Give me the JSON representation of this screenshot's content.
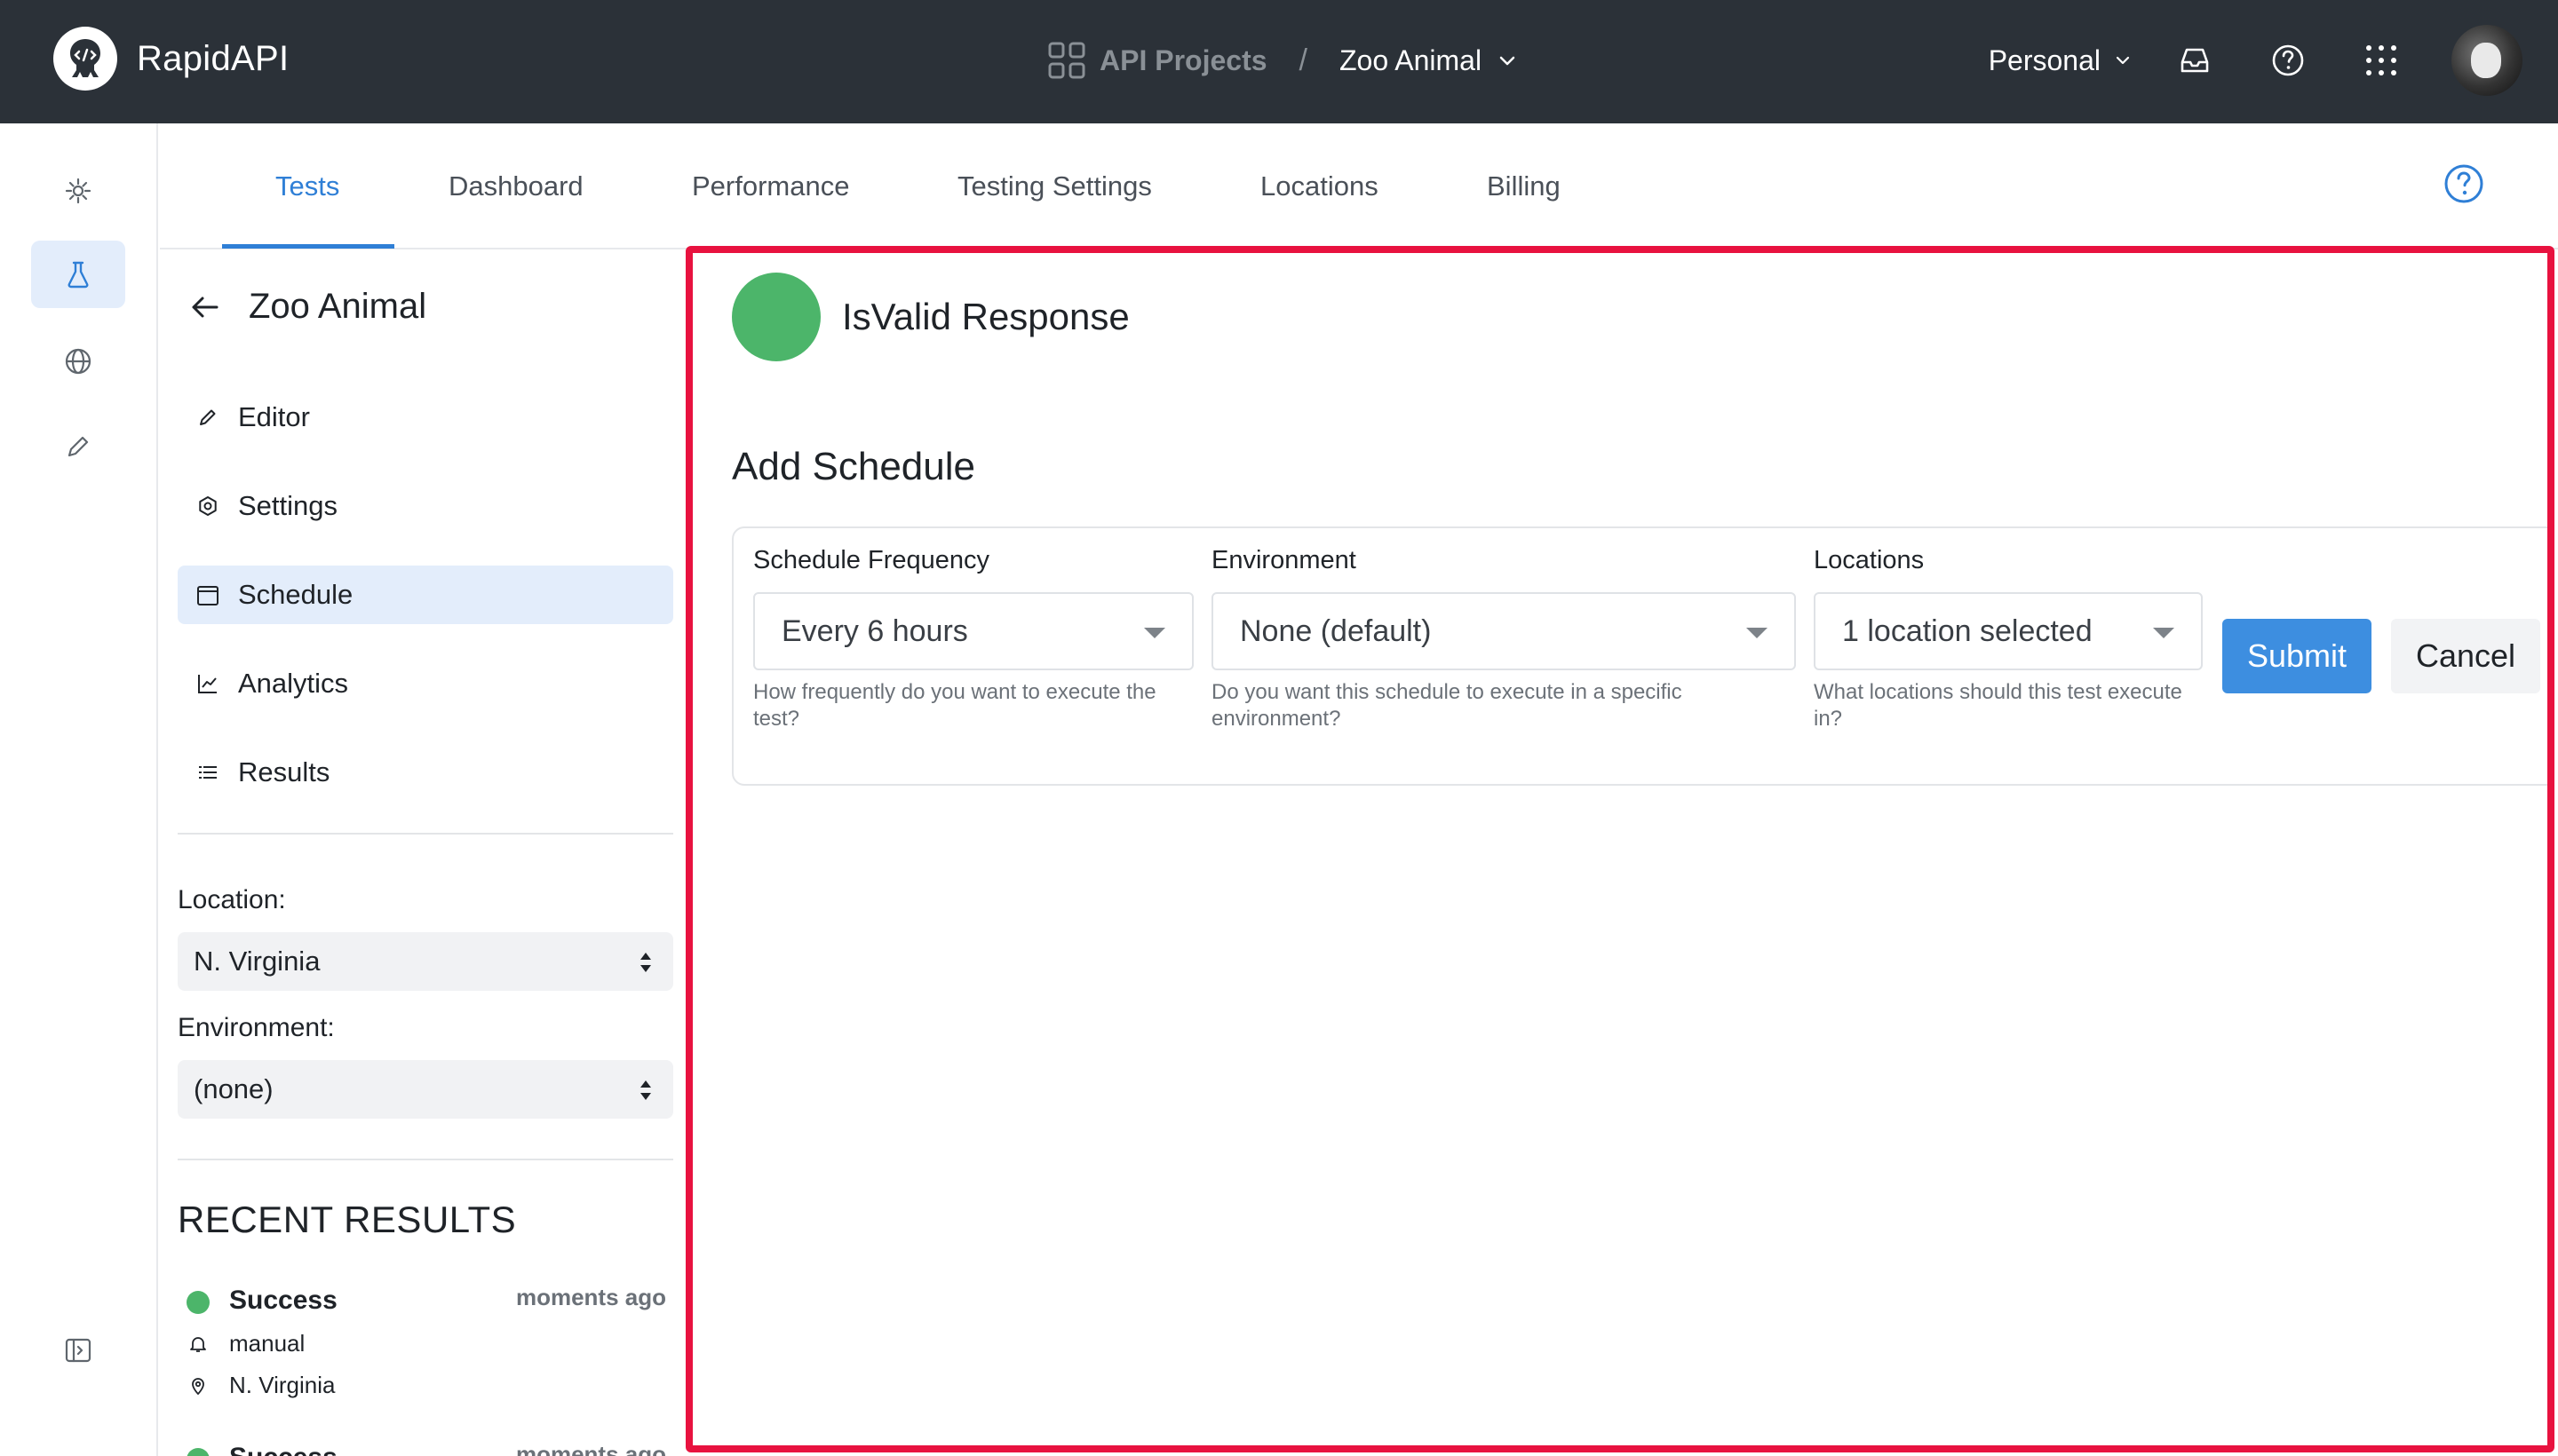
{
  "header": {
    "brand": "RapidAPI",
    "breadcrumb": {
      "projects": "API Projects",
      "separator": "/",
      "current": "Zoo Animal"
    },
    "workspace": "Personal"
  },
  "tabs": [
    "Tests",
    "Dashboard",
    "Performance",
    "Testing Settings",
    "Locations",
    "Billing"
  ],
  "sidebar": {
    "title": "Zoo Animal",
    "items": [
      "Editor",
      "Settings",
      "Schedule",
      "Analytics",
      "Results"
    ],
    "location_label": "Location:",
    "location_value": "N. Virginia",
    "environment_label": "Environment:",
    "environment_value": "(none)",
    "recent_title": "RECENT RESULTS",
    "recent": [
      {
        "status": "Success",
        "time": "moments ago",
        "trigger": "manual",
        "location": "N. Virginia"
      },
      {
        "status": "Success",
        "time": "moments ago"
      }
    ]
  },
  "main": {
    "test_name": "IsValid Response",
    "schedule_title": "Add Schedule",
    "fields": {
      "frequency": {
        "label": "Schedule Frequency",
        "value": "Every 6 hours",
        "help": "How frequently do you want to execute the test?"
      },
      "environment": {
        "label": "Environment",
        "value": "None (default)",
        "help": "Do you want this schedule to execute in a specific environment?"
      },
      "locations": {
        "label": "Locations",
        "value": "1 location selected",
        "help": "What locations should this test execute in?"
      }
    },
    "submit_label": "Submit",
    "cancel_label": "Cancel"
  },
  "colors": {
    "topbar": "#2b3138",
    "accent": "#3d8ee0",
    "highlight_border": "#e8123f",
    "success": "#4cb56a"
  }
}
